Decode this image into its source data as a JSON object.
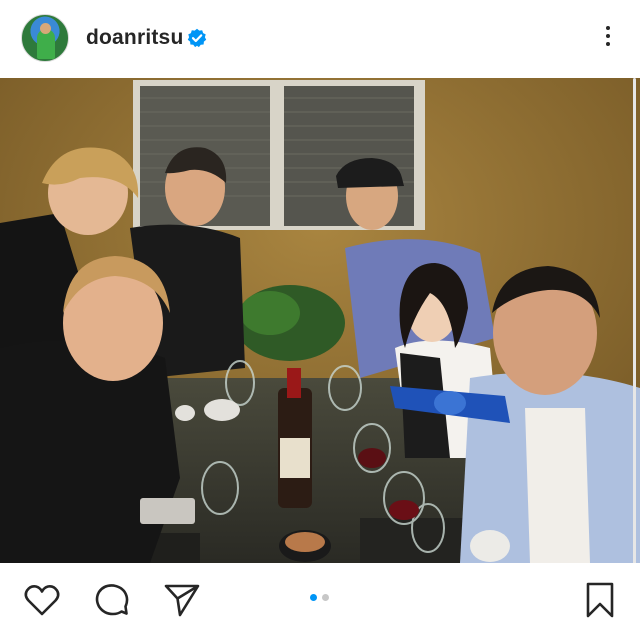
{
  "post": {
    "username": "doanritsu",
    "verified": true,
    "carousel": {
      "total": 2,
      "current": 1
    }
  },
  "icons": {
    "avatar": "profile-avatar",
    "verified": "verified-badge-icon",
    "more": "more-options-icon",
    "like": "heart-icon",
    "comment": "comment-icon",
    "share": "send-icon",
    "save": "bookmark-icon"
  },
  "colors": {
    "accent": "#0095f6",
    "text": "#262626",
    "dot_inactive": "#c7c7c7"
  }
}
